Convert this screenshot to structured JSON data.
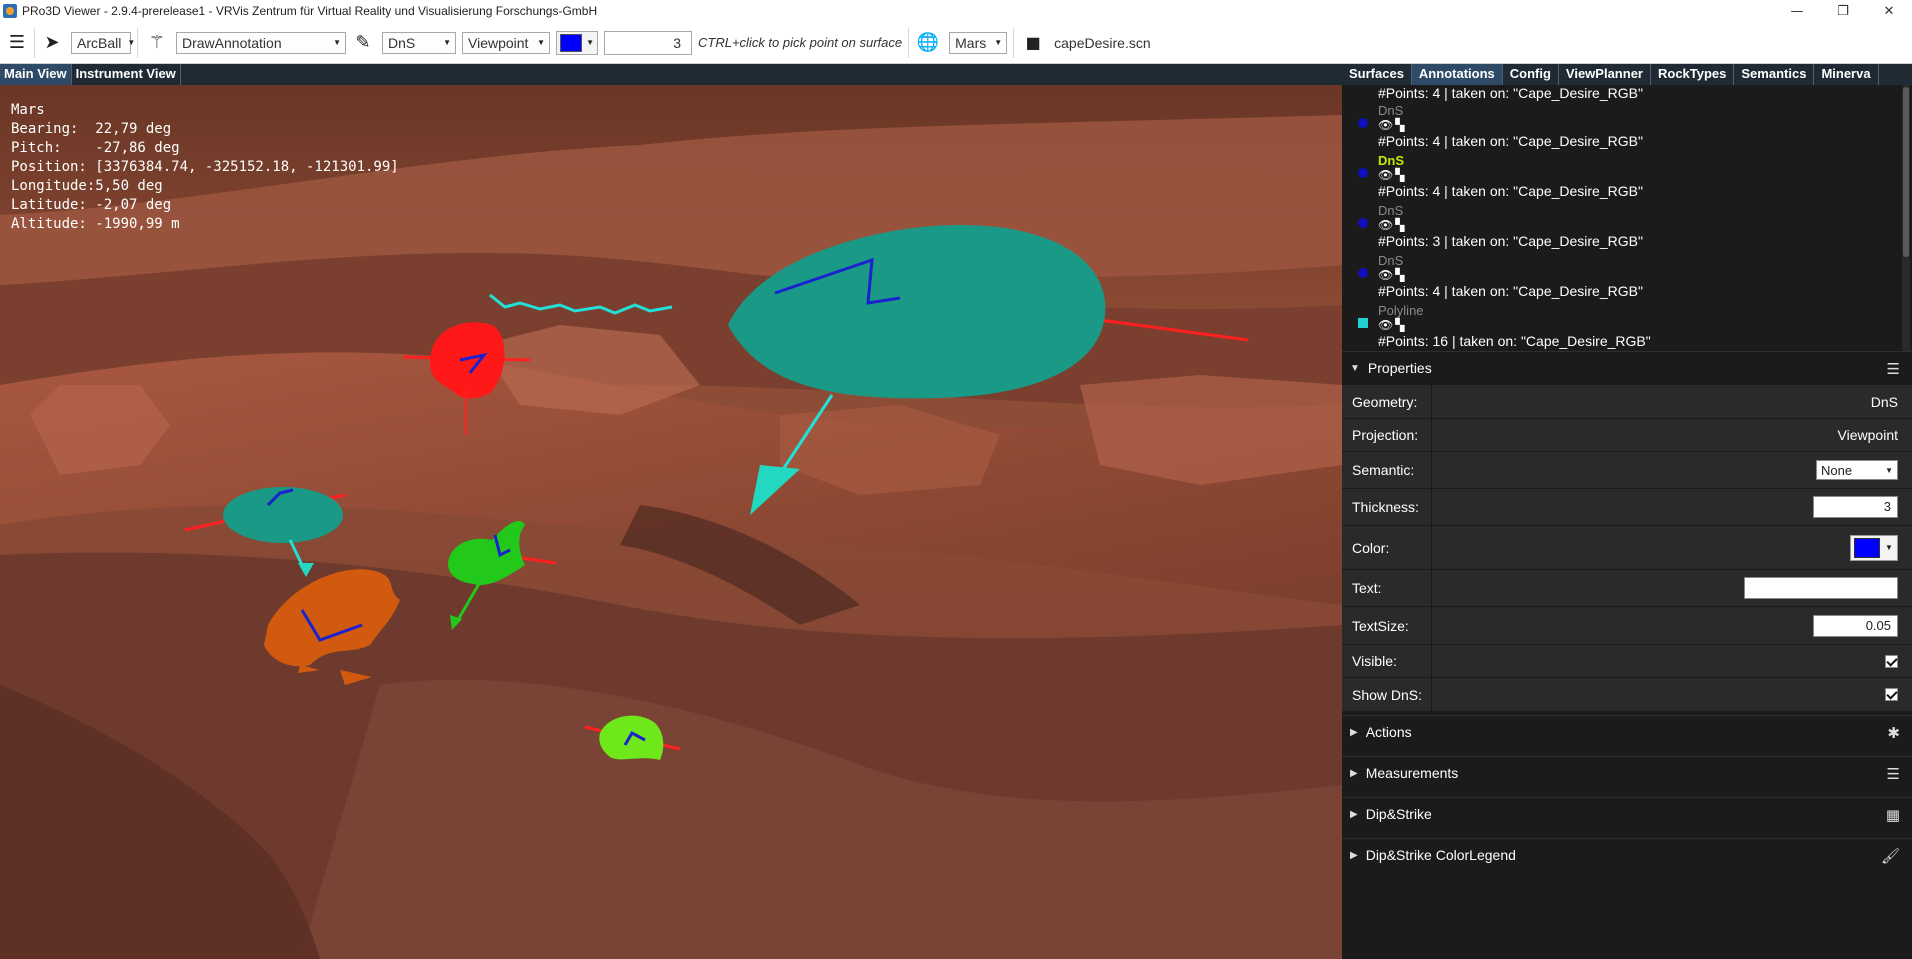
{
  "window": {
    "title": "PRo3D Viewer - 2.9.4-prerelease1 - VRVis Zentrum für Virtual Reality und Visualisierung Forschungs-GmbH",
    "minimize": "—",
    "maximize": "❐",
    "close": "✕"
  },
  "toolbar": {
    "menu_icon": "menu-icon",
    "nav_icon": "navigate-icon",
    "camera_mode": "ArcBall",
    "wand_icon": "magic-wand-icon",
    "interaction_mode": "DrawAnnotation",
    "pencil_icon": "pencil-icon",
    "geometry_mode": "DnS",
    "projection_mode": "Viewpoint",
    "annotation_color": "#0000ff",
    "thickness": "3",
    "hint": "CTRL+click to pick point on surface",
    "globe_icon": "globe-icon",
    "planet": "Mars",
    "folder_icon": "folder-icon",
    "scene_file": "capeDesire.scn"
  },
  "view_tabs": [
    {
      "label": "Main View",
      "active": true
    },
    {
      "label": "Instrument View",
      "active": false
    }
  ],
  "overlay": {
    "planet": "Mars",
    "bearing": "Bearing:  22,79 deg",
    "pitch": "Pitch:    -27,86 deg",
    "position": "Position: [3376384.74, -325152.18, -121301.99]",
    "longitude": "Longitude:5,50 deg",
    "latitude": "Latitude: -2,07 deg",
    "altitude": "Altitude: -1990,99 m"
  },
  "panel_tabs": [
    {
      "label": "Surfaces",
      "active": false
    },
    {
      "label": "Annotations",
      "active": true
    },
    {
      "label": "Config",
      "active": false
    },
    {
      "label": "ViewPlanner",
      "active": false
    },
    {
      "label": "RockTypes",
      "active": false
    },
    {
      "label": "Semantics",
      "active": false
    },
    {
      "label": "Minerva",
      "active": false
    }
  ],
  "annotations": {
    "first_detail": "#Points: 4 | taken on: \"Cape_Desire_RGB\"",
    "items": [
      {
        "name": "DnS",
        "highlighted": false,
        "detail": "#Points: 4 | taken on: \"Cape_Desire_RGB\"",
        "bullet_color": "#1010c0"
      },
      {
        "name": "DnS",
        "highlighted": true,
        "detail": "#Points: 4 | taken on: \"Cape_Desire_RGB\"",
        "bullet_color": "#1010c0"
      },
      {
        "name": "DnS",
        "highlighted": false,
        "detail": "#Points: 3 | taken on: \"Cape_Desire_RGB\"",
        "bullet_color": "#1010c0"
      },
      {
        "name": "DnS",
        "highlighted": false,
        "detail": "#Points: 4 | taken on: \"Cape_Desire_RGB\"",
        "bullet_color": "#1010c0"
      },
      {
        "name": "Polyline",
        "highlighted": false,
        "detail": "#Points: 16 | taken on: \"Cape_Desire_RGB\"",
        "bullet_color": "#22d0d0"
      }
    ],
    "visible_icon": "eye-icon",
    "fly_to_icon": "binoculars-icon"
  },
  "properties": {
    "header": "Properties",
    "geometry_label": "Geometry:",
    "geometry_value": "DnS",
    "projection_label": "Projection:",
    "projection_value": "Viewpoint",
    "semantic_label": "Semantic:",
    "semantic_value": "None",
    "thickness_label": "Thickness:",
    "thickness_value": "3",
    "color_label": "Color:",
    "color_value": "#0000ff",
    "text_label": "Text:",
    "text_value": "",
    "textsize_label": "TextSize:",
    "textsize_value": "0.05",
    "visible_label": "Visible:",
    "visible_checked": true,
    "showdns_label": "Show DnS:",
    "showdns_checked": true
  },
  "sections": {
    "actions": "Actions",
    "measurements": "Measurements",
    "dip_strike": "Dip&Strike",
    "dip_strike_legend": "Dip&Strike ColorLegend"
  },
  "colors": {
    "terrain": "#8a4a34",
    "panel_bg": "#1b1b1b",
    "tab_bg": "#1f2a35",
    "tab_active": "#2f4a66",
    "highlight": "#c8e600"
  }
}
